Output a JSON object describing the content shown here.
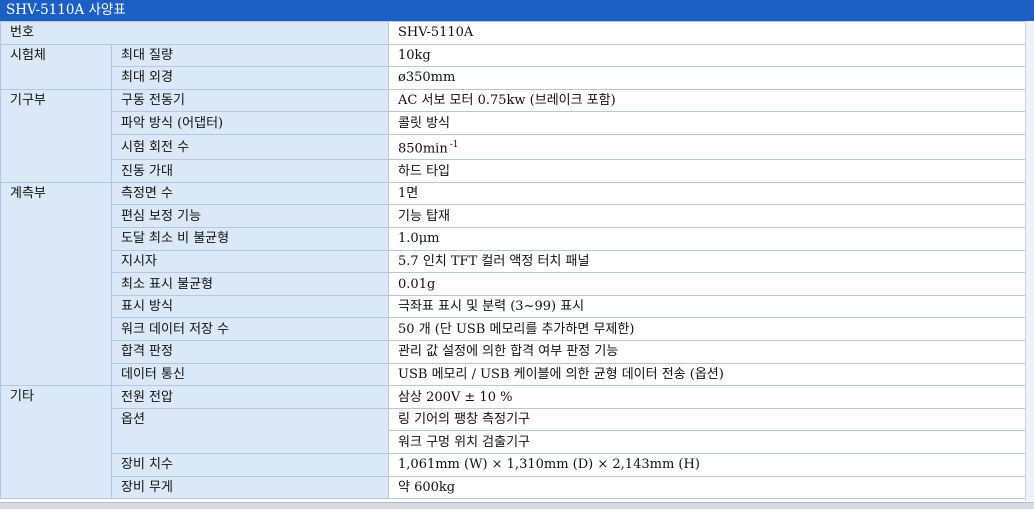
{
  "title": "SHV-5110A 사양표",
  "header": {
    "label": "번호",
    "value": "SHV-5110A"
  },
  "groups": [
    {
      "category": "시험체",
      "rows": [
        {
          "item": "최대 질량",
          "value": [
            "10kg"
          ]
        },
        {
          "item": "최대 외경",
          "value": [
            "ø350mm"
          ]
        }
      ]
    },
    {
      "category": "기구부",
      "rows": [
        {
          "item": "구동 전동기",
          "value": [
            "AC 서보 모터 0.75kw (브레이크 포함)"
          ]
        },
        {
          "item": "파악 방식 (어댑터)",
          "value": [
            "콜릿 방식"
          ]
        },
        {
          "item": "시험 회전 수",
          "value": [
            "850min"
          ],
          "sup": "-1"
        },
        {
          "item": "진동 가대",
          "value": [
            "하드 타입"
          ]
        }
      ]
    },
    {
      "category": "계측부",
      "rows": [
        {
          "item": "측정면 수",
          "value": [
            "1면"
          ]
        },
        {
          "item": "편심 보정 기능",
          "value": [
            "기능 탑재"
          ]
        },
        {
          "item": "도달 최소 비 불균형",
          "value": [
            "1.0μm"
          ]
        },
        {
          "item": "지시자",
          "value": [
            "5.7 인치 TFT 컬러 액정 터치 패널"
          ]
        },
        {
          "item": "최소 표시 불균형",
          "value": [
            "0.01g"
          ]
        },
        {
          "item": "표시 방식",
          "value": [
            "극좌표 표시 및 분력 (3~99) 표시"
          ]
        },
        {
          "item": "워크 데이터 저장 수",
          "value": [
            "50 개 (단 USB 메모리를 추가하면 무제한)"
          ]
        },
        {
          "item": "합격 판정",
          "value": [
            "관리 값 설정에 의한 합격 여부 판정 기능"
          ]
        },
        {
          "item": "데이터 통신",
          "value": [
            "USB 메모리 / USB 케이블에 의한 균형 데이터 전송 (옵션)"
          ]
        }
      ]
    },
    {
      "category": "기타",
      "rows": [
        {
          "item": "전원 전압",
          "value": [
            "삼상 200V ± 10 %"
          ]
        },
        {
          "item": "옵션",
          "value": [
            "링 기어의 팽창 측정기구",
            "워크 구멍 위치 검출기구"
          ]
        },
        {
          "item": "장비 치수",
          "value": [
            "1,061mm (W) × 1,310mm (D) × 2,143mm (H)"
          ]
        },
        {
          "item": "장비 무게",
          "value": [
            "약 600kg"
          ]
        }
      ]
    }
  ],
  "colors": {
    "title_bar": "#1c5fc4",
    "label_cell": "#dae8f8",
    "value_cell": "#ffffff",
    "border": "#b5c8df"
  }
}
